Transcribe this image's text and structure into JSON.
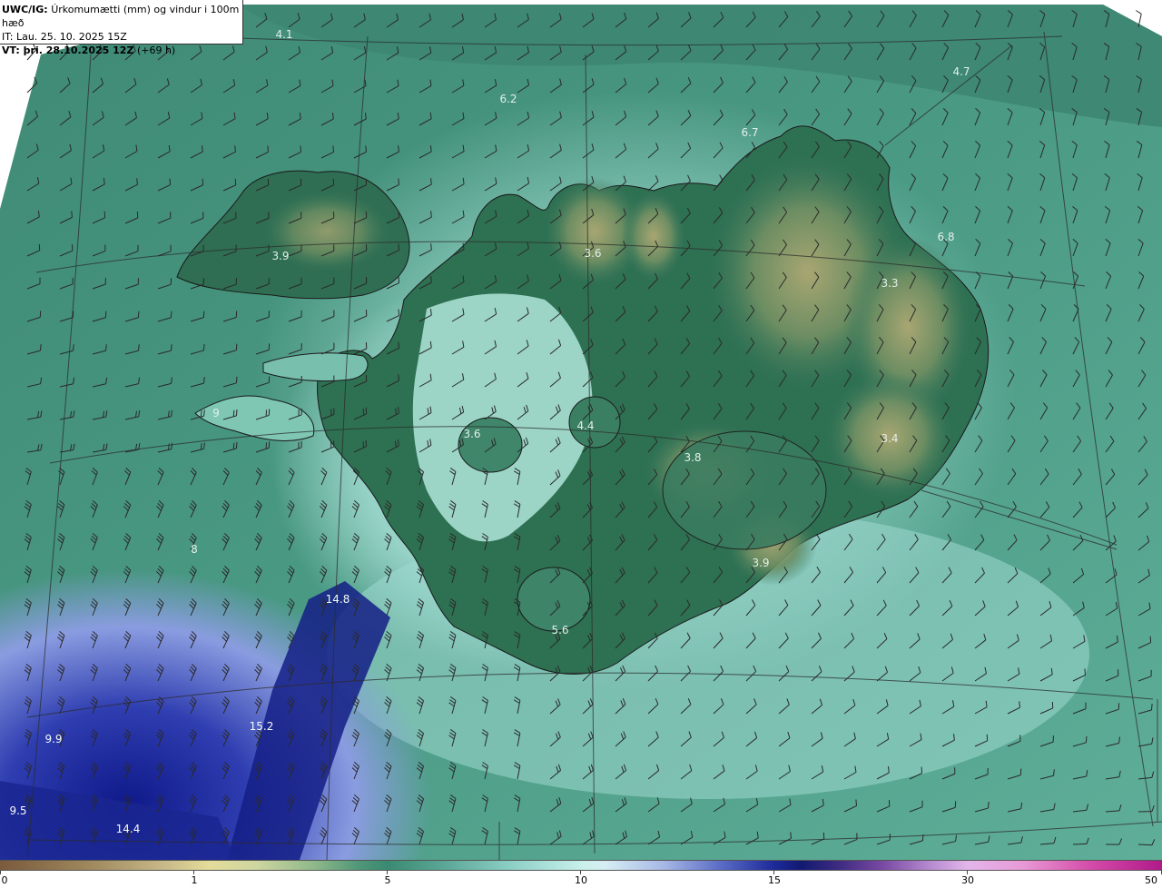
{
  "header": {
    "model_label": "UWC/IG:",
    "product": "Úrkomumætti (mm) og vindur i 100m hæð",
    "init_line": "IT: Lau. 25. 10. 2025 15Z",
    "valid_label": "VT: þri. 28.10.2025 12Z",
    "valid_offset": "(+69 h)"
  },
  "map": {
    "labels": [
      "4.1",
      "6.2",
      "4.7",
      "6.7",
      "6.8",
      "3.9",
      "3.6",
      "3.3",
      "4.4",
      "3.6",
      "3.8",
      "3.4",
      "3.9",
      "14.8",
      "5.6",
      "15.2",
      "9.9",
      "9.5",
      "14.4",
      "9",
      "8"
    ]
  },
  "colorbar": {
    "ticks": [
      "0",
      "1",
      "5",
      "10",
      "15",
      "30",
      "50"
    ]
  },
  "colors": {
    "sea_green": "#3f8f7a",
    "land_green": "#2f6e52",
    "highland": "#8a9a6a",
    "pale": "#c8f0ea",
    "deep_blue": "#1d2a9a"
  }
}
